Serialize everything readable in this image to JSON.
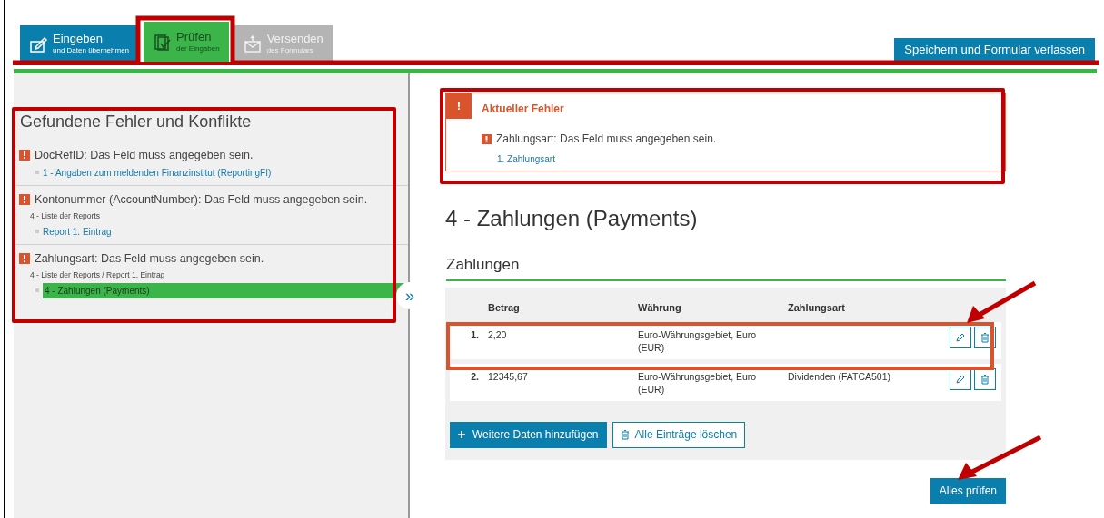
{
  "tabs": [
    {
      "label": "Eingeben",
      "sublabel": "und Daten übernehmen",
      "selected": false,
      "disabled": false
    },
    {
      "label": "Prüfen",
      "sublabel": "der Eingaben",
      "selected": true,
      "disabled": false
    },
    {
      "label": "Versenden",
      "sublabel": "des Formulars",
      "selected": false,
      "disabled": true
    }
  ],
  "save_button": "Speichern und Formular verlassen",
  "errors_panel": {
    "title": "Gefundene Fehler und Konflikte",
    "items": [
      {
        "message": "DocRefID: Das Feld muss angegeben sein.",
        "link": "1 - Angaben zum meldenden Finanzinstitut (ReportingFI)",
        "selected": false
      },
      {
        "message": "Kontonummer (AccountNumber): Das Feld muss angegeben sein.",
        "path": "4 - Liste der Reports",
        "link": "Report 1. Eintrag",
        "selected": false
      },
      {
        "message": "Zahlungsart: Das Feld muss angegeben sein.",
        "path": "4 - Liste der Reports / Report 1. Eintrag",
        "link": "4 - Zahlungen (Payments)",
        "selected": true
      }
    ],
    "toggle": "»"
  },
  "current_error": {
    "badge": "!",
    "title": "Aktueller Fehler",
    "message": "Zahlungsart: Das Feld muss angegeben sein.",
    "link": "1. Zahlungsart"
  },
  "page_title": "4 - Zahlungen (Payments)",
  "section_title": "Zahlungen",
  "table": {
    "columns": [
      "Betrag",
      "Währung",
      "Zahlungsart"
    ],
    "rows": [
      {
        "index": "1.",
        "cells": [
          "2,20",
          "Euro-Währungsgebiet, Euro (EUR)",
          ""
        ]
      },
      {
        "index": "2.",
        "cells": [
          "12345,67",
          "Euro-Währungsgebiet, Euro (EUR)",
          "Dividenden (FATCA501)"
        ]
      }
    ]
  },
  "add_button": "Weitere Daten hinzufügen",
  "clear_button": "Alle Einträge löschen",
  "check_all_button": "Alles prüfen"
}
